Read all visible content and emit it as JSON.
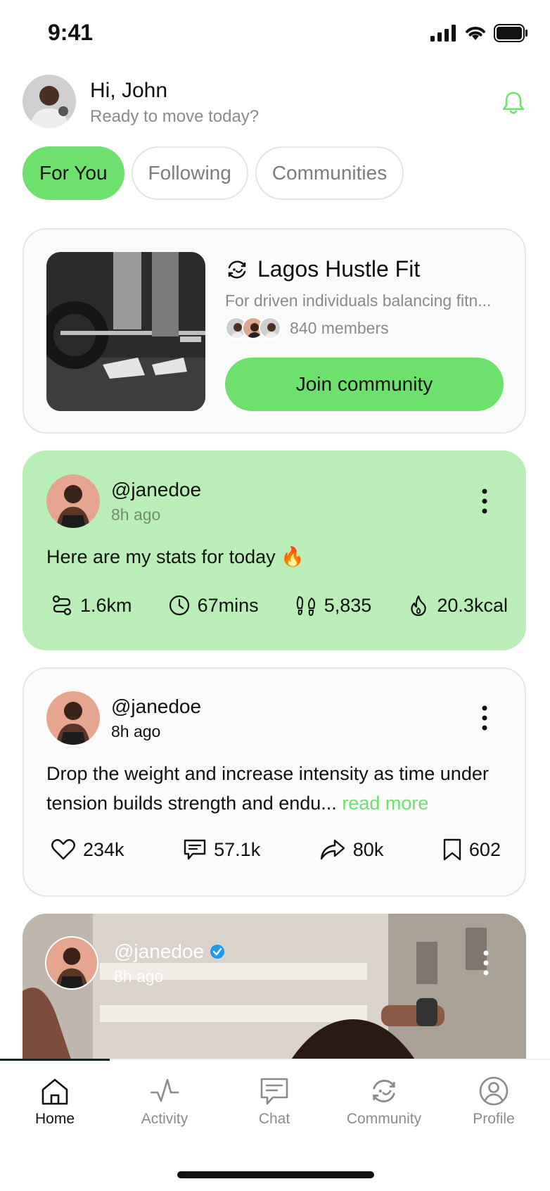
{
  "status": {
    "time": "9:41"
  },
  "header": {
    "greeting": "Hi, John",
    "subtitle": "Ready to move today?"
  },
  "tabs": [
    {
      "label": "For You",
      "active": true
    },
    {
      "label": "Following",
      "active": false
    },
    {
      "label": "Communities",
      "active": false
    }
  ],
  "community": {
    "name": "Lagos Hustle Fit",
    "description": "For driven individuals balancing fitn...",
    "members": "840 members",
    "join_label": "Join community"
  },
  "stats_post": {
    "user": "@janedoe",
    "time": "8h ago",
    "text": "Here are my stats for today 🔥",
    "stats": {
      "distance": "1.6km",
      "duration": "67mins",
      "steps": "5,835",
      "calories": "20.3kcal"
    }
  },
  "text_post": {
    "user": "@janedoe",
    "time": "8h ago",
    "text": "Drop the weight and increase intensity as time under tension builds strength and endu...",
    "read_more": "read more",
    "likes": "234k",
    "comments": "57.1k",
    "shares": "80k",
    "saves": "602"
  },
  "photo_post": {
    "user": "@janedoe",
    "time": "8h ago"
  },
  "nav": [
    {
      "label": "Home",
      "icon": "home-icon",
      "active": true
    },
    {
      "label": "Activity",
      "icon": "activity-icon",
      "active": false
    },
    {
      "label": "Chat",
      "icon": "chat-icon",
      "active": false
    },
    {
      "label": "Community",
      "icon": "community-icon",
      "active": false
    },
    {
      "label": "Profile",
      "icon": "profile-icon",
      "active": false
    }
  ],
  "colors": {
    "accent": "#6ee06e",
    "stats_bg": "#b9efb6",
    "muted": "#8b8b8b"
  }
}
